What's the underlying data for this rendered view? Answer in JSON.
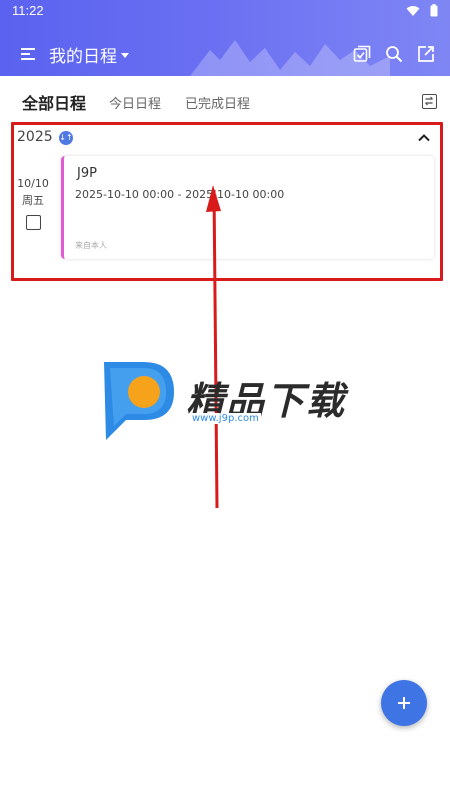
{
  "status_bar": {
    "time": "11:22"
  },
  "app_bar": {
    "title": "我的日程"
  },
  "tabs": [
    {
      "label": "全部日程",
      "active": true
    },
    {
      "label": "今日日程",
      "active": false
    },
    {
      "label": "已完成日程",
      "active": false
    }
  ],
  "year_section": {
    "year": "2025",
    "badge": "↓↑"
  },
  "event": {
    "date": "10/10",
    "weekday": "周五",
    "title": "J9P",
    "time_range": "2025-10-10 00:00 - 2025-10-10 00:00",
    "source": "来自本人",
    "accent_color": "#e15ad4"
  },
  "watermark": {
    "text": "精品下载",
    "url": "www.j9p.com"
  },
  "colors": {
    "header": "#5a62ef",
    "fab": "#3f74e4",
    "highlight": "#d81a1a"
  },
  "icons": {
    "status": [
      "wifi-icon",
      "battery-icon"
    ],
    "app_bar": [
      "menu-icon",
      "dropdown-caret-icon",
      "checklist-icon",
      "search-icon",
      "share-icon"
    ],
    "tabs_row": [
      "swap-icon"
    ],
    "year_row": [
      "sort-icon",
      "chevron-up-icon"
    ],
    "fab": "plus-icon"
  }
}
